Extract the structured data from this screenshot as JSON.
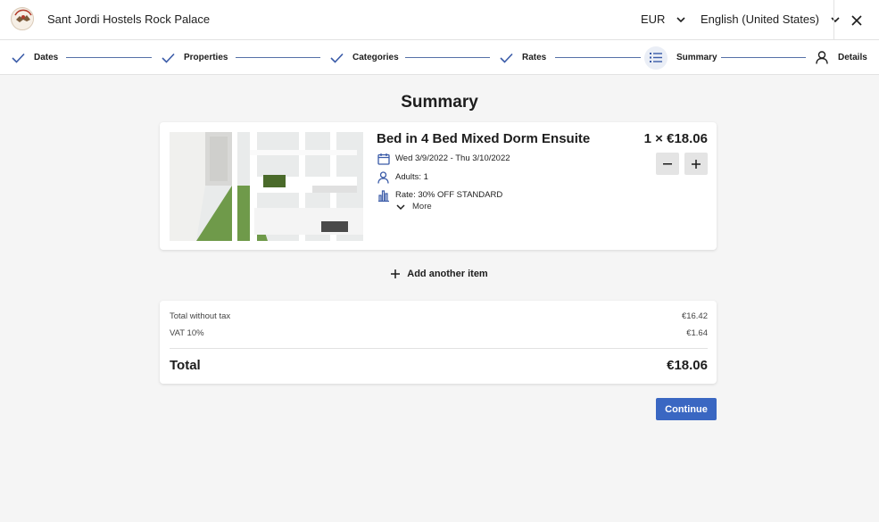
{
  "header": {
    "hotel_name": "Sant Jordi Hostels Rock Palace",
    "currency": "EUR",
    "language": "English (United States)"
  },
  "stepper": {
    "steps": [
      {
        "label": "Dates",
        "state": "done"
      },
      {
        "label": "Properties",
        "state": "done"
      },
      {
        "label": "Categories",
        "state": "done"
      },
      {
        "label": "Rates",
        "state": "done"
      },
      {
        "label": "Summary",
        "state": "current"
      },
      {
        "label": "Details",
        "state": "pending"
      }
    ]
  },
  "main": {
    "title": "Summary",
    "item": {
      "name": "Bed in 4 Bed Mixed Dorm Ensuite",
      "quantity_price": "1 × €18.06",
      "dates": "Wed 3/9/2022 - Thu 3/10/2022",
      "adults": "Adults: 1",
      "rate": "Rate: 30% OFF STANDARD",
      "more_label": "More"
    },
    "add_item_label": "Add another item",
    "totals": {
      "without_tax_label": "Total without tax",
      "without_tax_value": "€16.42",
      "vat_label": "VAT 10%",
      "vat_value": "€1.64",
      "total_label": "Total",
      "total_value": "€18.06"
    },
    "continue_label": "Continue"
  },
  "colors": {
    "accent": "#3a67c2",
    "step_line": "#5671a8",
    "icon_blue": "#3a5ba8"
  }
}
